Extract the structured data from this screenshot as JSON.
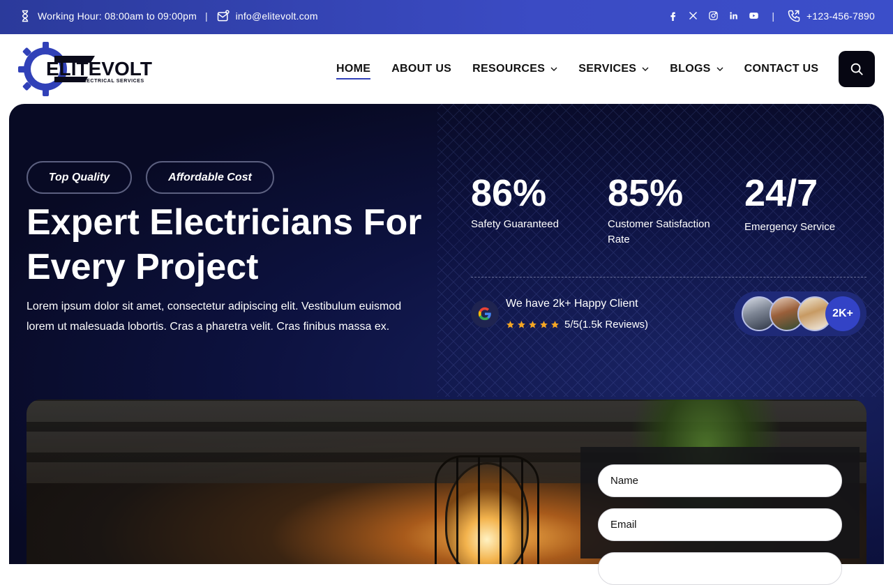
{
  "topbar": {
    "hours": "Working Hour: 08:00am to 09:00pm",
    "email": "info@elitevolt.com",
    "phone": "+123-456-7890",
    "separator": "|",
    "social": [
      "facebook-icon",
      "x-icon",
      "instagram-icon",
      "linkedin-icon",
      "youtube-icon"
    ]
  },
  "brand": {
    "name": "ELITEVOLT",
    "tagline": "ELECTRICAL SERVICES"
  },
  "nav": {
    "items": [
      {
        "label": "HOME",
        "dropdown": false,
        "active": true
      },
      {
        "label": "ABOUT US",
        "dropdown": false,
        "active": false
      },
      {
        "label": "RESOURCES",
        "dropdown": true,
        "active": false
      },
      {
        "label": "SERVICES",
        "dropdown": true,
        "active": false
      },
      {
        "label": "BLOGS",
        "dropdown": true,
        "active": false
      },
      {
        "label": "CONTACT US",
        "dropdown": false,
        "active": false
      }
    ]
  },
  "hero": {
    "tags": [
      "Top Quality",
      "Affordable Cost"
    ],
    "title_line1": "Expert Electricians For",
    "title_line2": "Every Project",
    "lead_line1": "Lorem ipsum dolor sit amet, consectetur adipiscing elit. Vestibulum euismod",
    "lead_line2": "lorem ut malesuada lobortis. Cras a pharetra velit. Cras finibus massa ex.",
    "stats": [
      {
        "value": "86%",
        "label_line1": "Safety Guaranteed",
        "label_line2": ""
      },
      {
        "value": "85%",
        "label_line1": "Customer Satisfaction",
        "label_line2": "Rate"
      },
      {
        "value": "24/7",
        "label_line1": "Emergency Service",
        "label_line2": ""
      }
    ],
    "review_title": "We have 2k+ Happy Client",
    "rating_text": "5/5(1.5k Reviews)",
    "rating_stars": 5,
    "clients_count": "2K+"
  },
  "form": {
    "name_placeholder": "Name",
    "email_placeholder": "Email"
  },
  "colors": {
    "topbar": "#3141b8",
    "accent": "#3343c6",
    "hero_bg": "#0b0f33",
    "star": "#f5a623"
  }
}
